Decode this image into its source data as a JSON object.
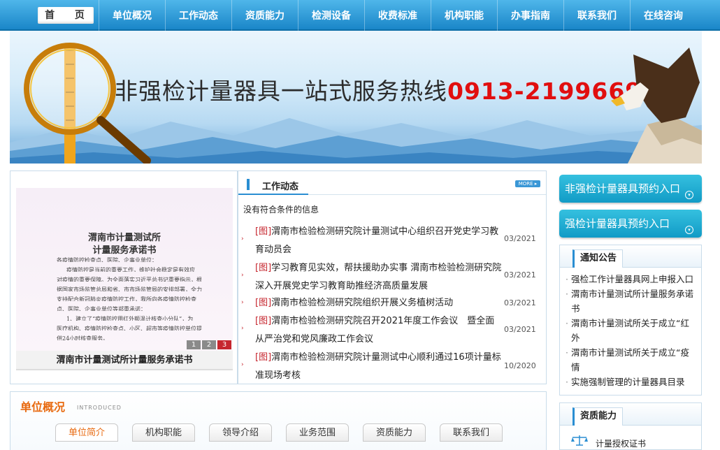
{
  "nav": {
    "items": [
      "首 页",
      "单位概况",
      "工作动态",
      "资质能力",
      "检测设备",
      "收费标准",
      "机构职能",
      "办事指南",
      "联系我们",
      "在线咨询"
    ]
  },
  "banner": {
    "slogan": "非强检计量器具一站式服务热线",
    "phone": "0913-2199669"
  },
  "photo": {
    "doc_title_1": "渭南市计量测试所",
    "doc_title_2": "计量服务承诺书",
    "doc_lines": [
      "各疫情防控检查点、医院、企事业单位：",
      "疫情防控是当前的重要工作，维护社会稳定是有效应",
      "对疫情的重要保障。为全面落实习近平总书记重要指示，根",
      "据国家市场监管总局和省、市市场监管局的安排部署，全力",
      "支持配合新冠肺炎疫情防控工作，我所向各疫情防控检查",
      "点、医院、企事业单位等郑重承诺：",
      "1、建立了“疫情防控用红外额温计核查小分队”，为",
      "医疗机构、疫情防控检查点、小区、超市等疫情防控单位提",
      "供24小时核查服务。"
    ],
    "pager": [
      "1",
      "2",
      "3"
    ],
    "caption": "渭南市计量测试所计量服务承诺书"
  },
  "news": {
    "title": "工作动态",
    "more": "MORE ▸",
    "no_match": "没有符合条件的信息",
    "items": [
      {
        "tag": "[图]",
        "text": "渭南市检验检测研究院计量测试中心组织召开党史学习教育动员会",
        "date": "03/2021"
      },
      {
        "tag": "[图]",
        "text": "学习教育见实效，帮扶援助办实事 渭南市检验检测研究院深入开展党史学习教育助推经济高质量发展",
        "date": "03/2021"
      },
      {
        "tag": "[图]",
        "text": "渭南市检验检测研究院组织开展义务植树活动",
        "date": "03/2021"
      },
      {
        "tag": "[图]",
        "text": "渭南市检验检测研究院召开2021年度工作会议　暨全面从严治党和党风廉政工作会议",
        "date": "03/2021"
      },
      {
        "tag": "[图]",
        "text": "渭南市检验检测研究院计量测试中心顺利通过16项计量标准现场考核",
        "date": "10/2020"
      }
    ]
  },
  "sidebar": {
    "cta1": "非强检计量器具预约入口",
    "cta2": "强检计量器具预约入口",
    "notice_title": "通知公告",
    "notices": [
      "强检工作计量器具网上申报入口",
      "渭南市计量测试所计量服务承诺书",
      "渭南市计量测试所关于成立“红外",
      "渭南市计量测试所关于成立“疫情",
      "实施强制管理的计量器具目录"
    ],
    "qual_title": "资质能力",
    "qual_item": "计量授权证书"
  },
  "about": {
    "title": "单位概况",
    "subtitle": "INTRODUCED",
    "tabs": [
      "单位简介",
      "机构职能",
      "领导介绍",
      "业务范围",
      "资质能力",
      "联系我们"
    ]
  },
  "colors": {
    "nav": "#1a86c8",
    "accent_red": "#e10f0f",
    "accent_orange": "#e86a10",
    "cta": "#119bc6"
  }
}
